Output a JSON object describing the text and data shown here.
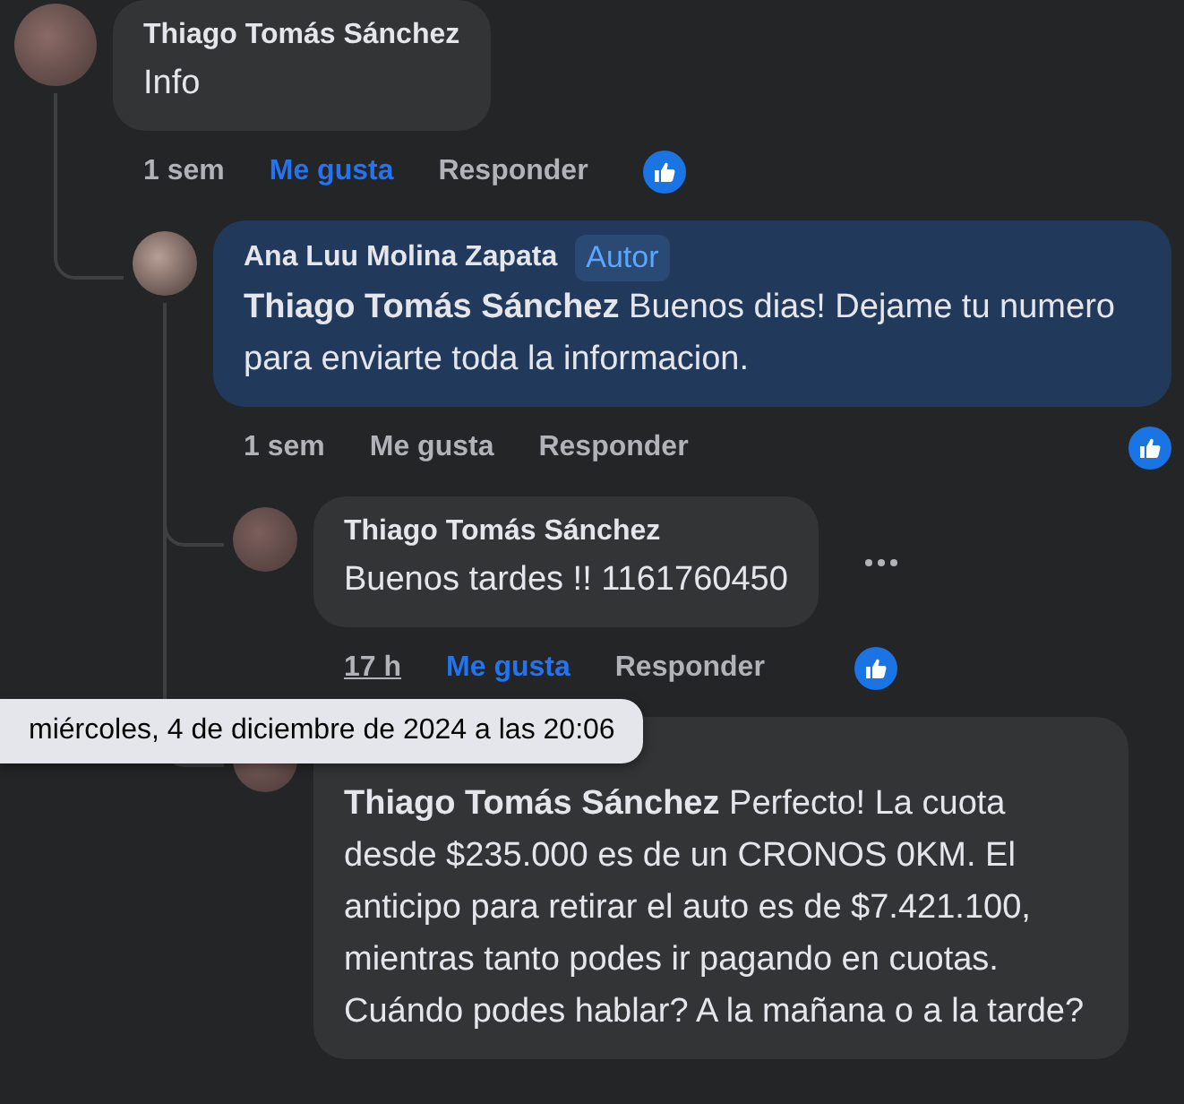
{
  "thread": [
    {
      "author": "Thiago Tomás Sánchez",
      "text": "Info",
      "time": "1 sem",
      "like_label": "Me gusta",
      "liked": true,
      "reply_label": "Responder",
      "reacted": true,
      "children": [
        {
          "author": "Ana Luu Molina Zapata",
          "badge": "Autor",
          "highlighted": true,
          "mention": "Thiago Tomás Sánchez",
          "text": "Buenos dias! Dejame tu numero para enviarte toda la informacion.",
          "time": "1 sem",
          "like_label": "Me gusta",
          "liked": false,
          "reply_label": "Responder",
          "reacted": true,
          "children": [
            {
              "author": "Thiago Tomás Sánchez",
              "text": "Buenos tardes !! 1161760450",
              "time": "17 h",
              "time_hovered": true,
              "like_label": "Me gusta",
              "liked": true,
              "reply_label": "Responder",
              "reacted": true,
              "menu": true
            },
            {
              "highlighted": false,
              "mention": "Thiago Tomás Sánchez",
              "text": "Perfecto! La cuota desde $235.000 es de un CRONOS 0KM. El anticipo para retirar el auto es de $7.421.100, mientras tanto podes ir pagando en cuotas. Cuándo podes hablar? A la mañana o a la tarde?"
            }
          ]
        }
      ]
    }
  ],
  "tooltip": "miércoles, 4 de diciembre de 2024 a las 20:06"
}
